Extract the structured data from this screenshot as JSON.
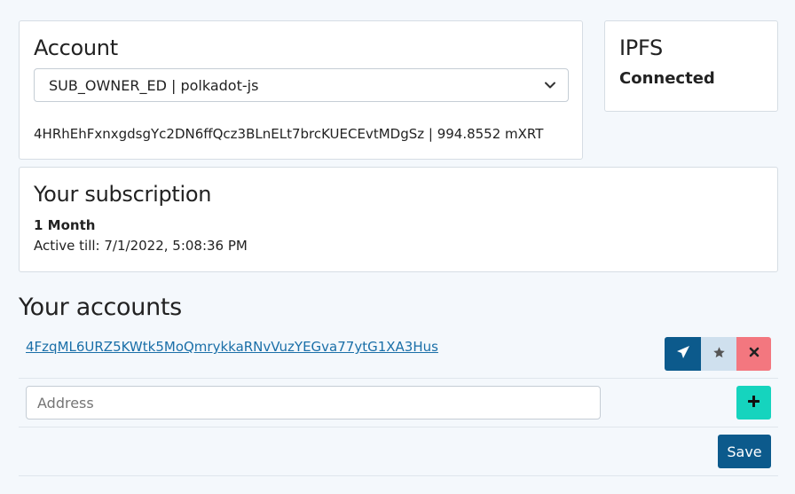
{
  "account": {
    "title": "Account",
    "selected": "SUB_OWNER_ED | polkadot-js",
    "info": "4HRhEhFxnxgdsgYc2DN6ffQcz3BLnELt7brcKUECEvtMDgSz | 994.8552 mXRT"
  },
  "ipfs": {
    "title": "IPFS",
    "status": "Connected"
  },
  "subscription": {
    "title": "Your subscription",
    "plan": "1 Month",
    "active_till": "Active till: 7/1/2022, 5:08:36 PM"
  },
  "accounts": {
    "title": "Your accounts",
    "items": [
      {
        "address": "4FzqML6URZ5KWtk5MoQmrykkaRNvVuzYEGva77ytG1XA3Hus"
      }
    ],
    "address_placeholder": "Address",
    "save_label": "Save"
  },
  "icons": {
    "send": "paper-plane-icon",
    "favorite": "star-icon",
    "delete": "close-icon",
    "add": "plus-icon",
    "dropdown": "chevron-down-icon"
  },
  "colors": {
    "primary": "#0c5a8c",
    "favorite_bg": "#cfe0ee",
    "danger": "#f3777f",
    "add": "#15d4be",
    "link": "#1a6fa8"
  }
}
